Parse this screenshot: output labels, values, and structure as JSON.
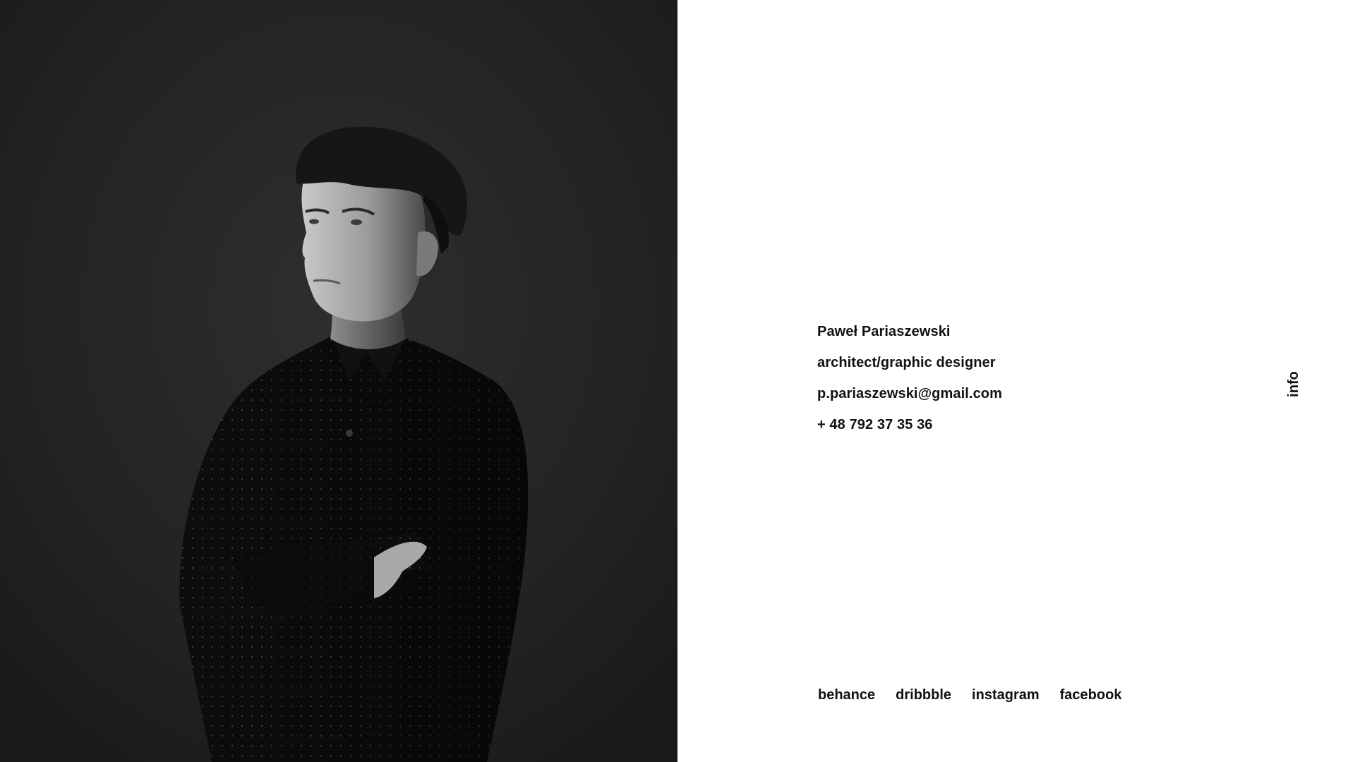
{
  "portrait": {
    "description_icon": "portrait-photo",
    "background_color": "#232323"
  },
  "contact": {
    "name": "Paweł Pariaszewski",
    "role": "architect/graphic designer",
    "email": "p.pariaszewski@gmail.com",
    "phone": "+ 48 792 37 35 36"
  },
  "social": {
    "links": [
      {
        "label": "behance"
      },
      {
        "label": "dribbble"
      },
      {
        "label": "instagram"
      },
      {
        "label": "facebook"
      }
    ]
  },
  "sidebar": {
    "info_label": "info"
  },
  "colors": {
    "text": "#111111",
    "background": "#ffffff",
    "photo_bg": "#232323"
  }
}
